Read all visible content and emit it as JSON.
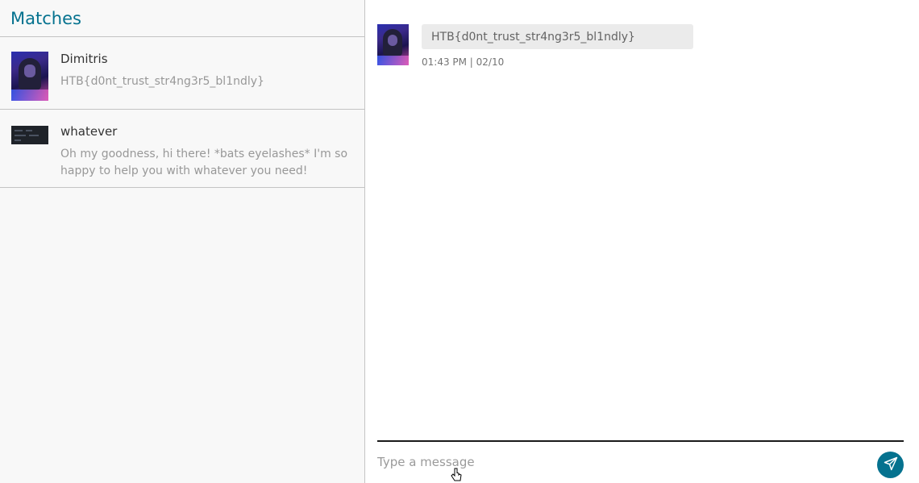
{
  "sidebar": {
    "title": "Matches",
    "matches": [
      {
        "name": "Dimitris",
        "preview": "HTB{d0nt_trust_str4ng3r5_bl1ndly}"
      },
      {
        "name": "whatever",
        "preview": "Oh my goodness, hi there! *bats eyelashes* I'm so happy to help you with whatever you need!"
      }
    ]
  },
  "chat": {
    "messages": [
      {
        "text": "HTB{d0nt_trust_str4ng3r5_bl1ndly}",
        "time": "01:43 PM | 02/10"
      }
    ],
    "composer": {
      "placeholder": "Type a message"
    }
  },
  "icons": {
    "send": "paper-plane-icon"
  },
  "colors": {
    "accent": "#05728f",
    "bubble": "#ebebeb",
    "panel": "#f8f8f8"
  }
}
